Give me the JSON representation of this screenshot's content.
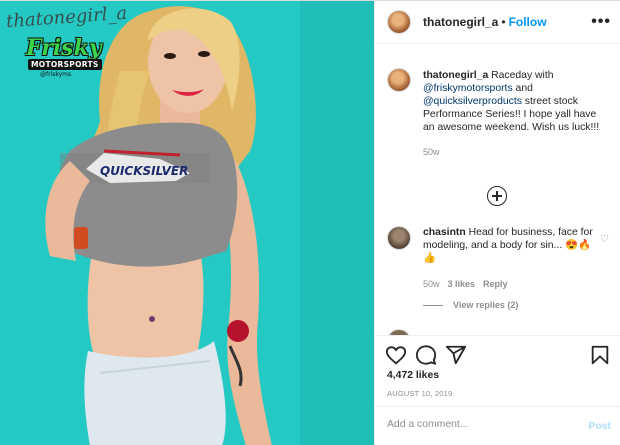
{
  "post": {
    "image": {
      "watermark_signature": "thatonegirl_a",
      "logo_title": "Frisky",
      "logo_subtitle": "MOTORSPORTS",
      "logo_tag": "@friskyms",
      "shirt_text": "QUICKSILVER",
      "colors": {
        "background": "#25c9c4",
        "shirt": "#8c8c8c",
        "shorts": "#dfe8ee",
        "hair": "#e9c878"
      }
    },
    "header": {
      "username": "thatonegirl_a",
      "separator": "•",
      "follow_label": "Follow",
      "more_icon": "more-options-icon",
      "more_label": "•••"
    },
    "caption": {
      "username": "thatonegirl_a",
      "text_1": " Raceday with ",
      "tag_1": "@friskymotorsports",
      "text_2": " and ",
      "tag_2": "@quicksilverproducts",
      "text_3": " street stock Performance Series!! I hope yall have an awesome weekend. Wish us luck!!!",
      "age": "50w"
    },
    "comments": [
      {
        "username": "chasintn",
        "text": " Head for business, face for modeling, and a body for sin... 😍🔥👍",
        "age": "50w",
        "likes": "3 likes",
        "reply_label": "Reply",
        "view_replies": "View replies (2)"
      }
    ],
    "actions": {
      "like_icon": "heart-icon",
      "comment_icon": "comment-icon",
      "share_icon": "share-icon",
      "save_icon": "bookmark-icon"
    },
    "likes_count": "4,472 likes",
    "date": "AUGUST 10, 2019",
    "add_comment": {
      "placeholder": "Add a comment...",
      "post_label": "Post"
    },
    "accent": "#0095f6"
  }
}
